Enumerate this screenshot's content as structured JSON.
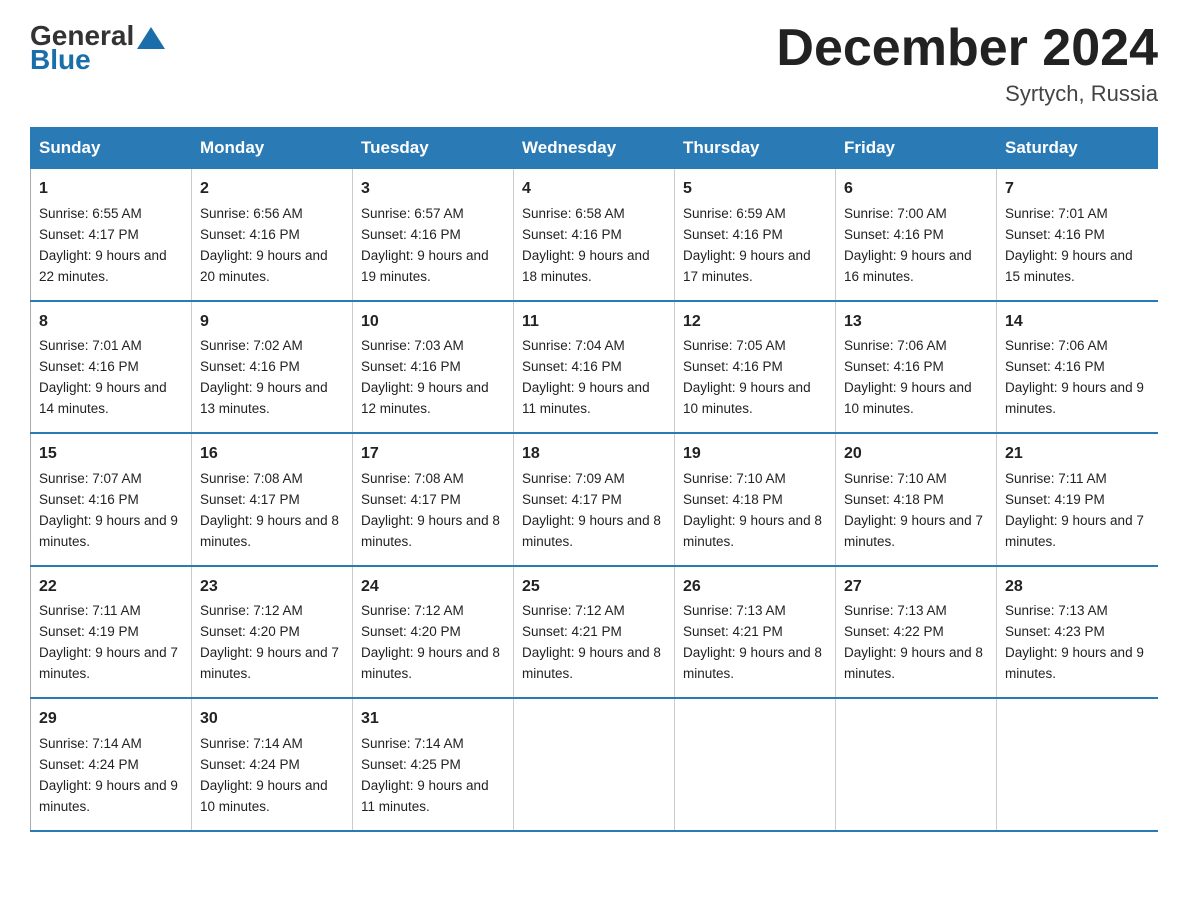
{
  "logo": {
    "general": "General",
    "triangle": "",
    "blue": "Blue"
  },
  "title": "December 2024",
  "location": "Syrtych, Russia",
  "days_of_week": [
    "Sunday",
    "Monday",
    "Tuesday",
    "Wednesday",
    "Thursday",
    "Friday",
    "Saturday"
  ],
  "weeks": [
    [
      {
        "day": "1",
        "sunrise": "Sunrise: 6:55 AM",
        "sunset": "Sunset: 4:17 PM",
        "daylight": "Daylight: 9 hours and 22 minutes."
      },
      {
        "day": "2",
        "sunrise": "Sunrise: 6:56 AM",
        "sunset": "Sunset: 4:16 PM",
        "daylight": "Daylight: 9 hours and 20 minutes."
      },
      {
        "day": "3",
        "sunrise": "Sunrise: 6:57 AM",
        "sunset": "Sunset: 4:16 PM",
        "daylight": "Daylight: 9 hours and 19 minutes."
      },
      {
        "day": "4",
        "sunrise": "Sunrise: 6:58 AM",
        "sunset": "Sunset: 4:16 PM",
        "daylight": "Daylight: 9 hours and 18 minutes."
      },
      {
        "day": "5",
        "sunrise": "Sunrise: 6:59 AM",
        "sunset": "Sunset: 4:16 PM",
        "daylight": "Daylight: 9 hours and 17 minutes."
      },
      {
        "day": "6",
        "sunrise": "Sunrise: 7:00 AM",
        "sunset": "Sunset: 4:16 PM",
        "daylight": "Daylight: 9 hours and 16 minutes."
      },
      {
        "day": "7",
        "sunrise": "Sunrise: 7:01 AM",
        "sunset": "Sunset: 4:16 PM",
        "daylight": "Daylight: 9 hours and 15 minutes."
      }
    ],
    [
      {
        "day": "8",
        "sunrise": "Sunrise: 7:01 AM",
        "sunset": "Sunset: 4:16 PM",
        "daylight": "Daylight: 9 hours and 14 minutes."
      },
      {
        "day": "9",
        "sunrise": "Sunrise: 7:02 AM",
        "sunset": "Sunset: 4:16 PM",
        "daylight": "Daylight: 9 hours and 13 minutes."
      },
      {
        "day": "10",
        "sunrise": "Sunrise: 7:03 AM",
        "sunset": "Sunset: 4:16 PM",
        "daylight": "Daylight: 9 hours and 12 minutes."
      },
      {
        "day": "11",
        "sunrise": "Sunrise: 7:04 AM",
        "sunset": "Sunset: 4:16 PM",
        "daylight": "Daylight: 9 hours and 11 minutes."
      },
      {
        "day": "12",
        "sunrise": "Sunrise: 7:05 AM",
        "sunset": "Sunset: 4:16 PM",
        "daylight": "Daylight: 9 hours and 10 minutes."
      },
      {
        "day": "13",
        "sunrise": "Sunrise: 7:06 AM",
        "sunset": "Sunset: 4:16 PM",
        "daylight": "Daylight: 9 hours and 10 minutes."
      },
      {
        "day": "14",
        "sunrise": "Sunrise: 7:06 AM",
        "sunset": "Sunset: 4:16 PM",
        "daylight": "Daylight: 9 hours and 9 minutes."
      }
    ],
    [
      {
        "day": "15",
        "sunrise": "Sunrise: 7:07 AM",
        "sunset": "Sunset: 4:16 PM",
        "daylight": "Daylight: 9 hours and 9 minutes."
      },
      {
        "day": "16",
        "sunrise": "Sunrise: 7:08 AM",
        "sunset": "Sunset: 4:17 PM",
        "daylight": "Daylight: 9 hours and 8 minutes."
      },
      {
        "day": "17",
        "sunrise": "Sunrise: 7:08 AM",
        "sunset": "Sunset: 4:17 PM",
        "daylight": "Daylight: 9 hours and 8 minutes."
      },
      {
        "day": "18",
        "sunrise": "Sunrise: 7:09 AM",
        "sunset": "Sunset: 4:17 PM",
        "daylight": "Daylight: 9 hours and 8 minutes."
      },
      {
        "day": "19",
        "sunrise": "Sunrise: 7:10 AM",
        "sunset": "Sunset: 4:18 PM",
        "daylight": "Daylight: 9 hours and 8 minutes."
      },
      {
        "day": "20",
        "sunrise": "Sunrise: 7:10 AM",
        "sunset": "Sunset: 4:18 PM",
        "daylight": "Daylight: 9 hours and 7 minutes."
      },
      {
        "day": "21",
        "sunrise": "Sunrise: 7:11 AM",
        "sunset": "Sunset: 4:19 PM",
        "daylight": "Daylight: 9 hours and 7 minutes."
      }
    ],
    [
      {
        "day": "22",
        "sunrise": "Sunrise: 7:11 AM",
        "sunset": "Sunset: 4:19 PM",
        "daylight": "Daylight: 9 hours and 7 minutes."
      },
      {
        "day": "23",
        "sunrise": "Sunrise: 7:12 AM",
        "sunset": "Sunset: 4:20 PM",
        "daylight": "Daylight: 9 hours and 7 minutes."
      },
      {
        "day": "24",
        "sunrise": "Sunrise: 7:12 AM",
        "sunset": "Sunset: 4:20 PM",
        "daylight": "Daylight: 9 hours and 8 minutes."
      },
      {
        "day": "25",
        "sunrise": "Sunrise: 7:12 AM",
        "sunset": "Sunset: 4:21 PM",
        "daylight": "Daylight: 9 hours and 8 minutes."
      },
      {
        "day": "26",
        "sunrise": "Sunrise: 7:13 AM",
        "sunset": "Sunset: 4:21 PM",
        "daylight": "Daylight: 9 hours and 8 minutes."
      },
      {
        "day": "27",
        "sunrise": "Sunrise: 7:13 AM",
        "sunset": "Sunset: 4:22 PM",
        "daylight": "Daylight: 9 hours and 8 minutes."
      },
      {
        "day": "28",
        "sunrise": "Sunrise: 7:13 AM",
        "sunset": "Sunset: 4:23 PM",
        "daylight": "Daylight: 9 hours and 9 minutes."
      }
    ],
    [
      {
        "day": "29",
        "sunrise": "Sunrise: 7:14 AM",
        "sunset": "Sunset: 4:24 PM",
        "daylight": "Daylight: 9 hours and 9 minutes."
      },
      {
        "day": "30",
        "sunrise": "Sunrise: 7:14 AM",
        "sunset": "Sunset: 4:24 PM",
        "daylight": "Daylight: 9 hours and 10 minutes."
      },
      {
        "day": "31",
        "sunrise": "Sunrise: 7:14 AM",
        "sunset": "Sunset: 4:25 PM",
        "daylight": "Daylight: 9 hours and 11 minutes."
      },
      null,
      null,
      null,
      null
    ]
  ]
}
